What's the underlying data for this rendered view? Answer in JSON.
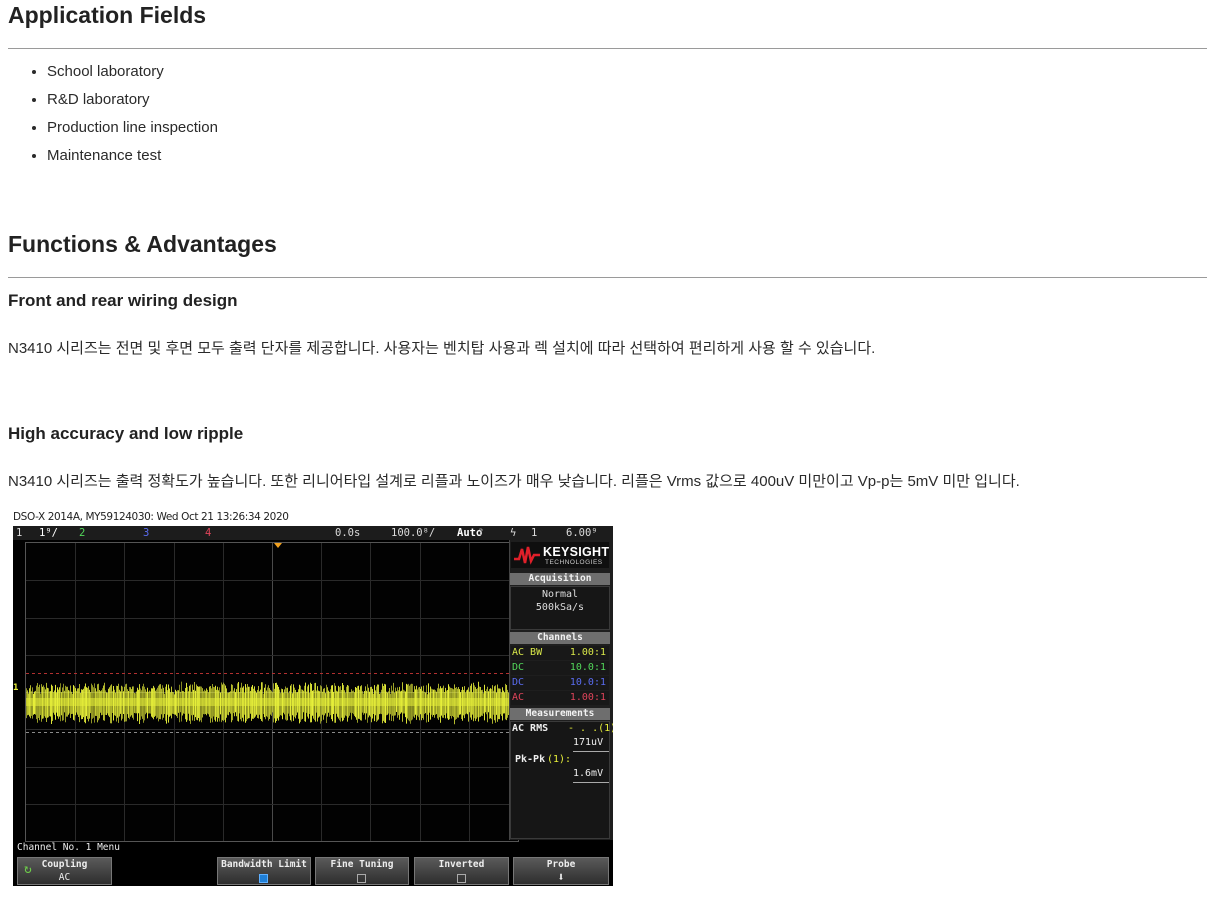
{
  "sections": {
    "application_title": "Application Fields",
    "application_items": [
      "School laboratory",
      "R&D laboratory",
      "Production line inspection",
      "Maintenance test"
    ],
    "functions_title": "Functions & Advantages",
    "wiring_title": "Front and rear wiring design",
    "wiring_text": "N3410 시리즈는 전면 및 후면 모두 출력 단자를 제공합니다. 사용자는 벤치탑 사용과 렉 설치에 따라 선택하여 편리하게 사용 할 수 있습니다.",
    "accuracy_title": "High accuracy and low ripple",
    "accuracy_text": "N3410 시리즈는 출력 정확도가 높습니다.   또한 리니어타입 설계로 리플과 노이즈가 매우 낮습니다. 리플은 Vrms 값으로 400uV 미만이고 Vp-p는 5mV 미만 입니다."
  },
  "scope": {
    "caption": "DSO-X 2014A, MY59124030: Wed Oct 21 13:26:34 2020",
    "top": {
      "ch1_scale": "1",
      "ch1_value": "1⁹/",
      "ch2": "2",
      "ch3": "3",
      "ch4": "4",
      "time_offset": "0.0s",
      "timebase": "100.0⁸/",
      "trigger_mode": "Auto",
      "trigger_symbol": "?",
      "trigger_src": "1",
      "trigger_level": "6.00⁹"
    },
    "logo_text": "KEYSIGHT",
    "logo_sub": "TECHNOLOGIES",
    "acquisition_head": "Acquisition",
    "acq_mode": "Normal",
    "acq_rate": "500kSa/s",
    "channels_head": "Channels",
    "channels": [
      {
        "coupling": "AC BW",
        "probe": "1.00:1",
        "color": "#d9e84a"
      },
      {
        "coupling": "DC",
        "probe": "10.0:1",
        "color": "#52d65a"
      },
      {
        "coupling": "DC",
        "probe": "10.0:1",
        "color": "#5a6cf0"
      },
      {
        "coupling": "AC",
        "probe": "1.00:1",
        "color": "#e0445a"
      }
    ],
    "measurements_head": "Measurements",
    "meas1_label": "AC RMS",
    "meas1_tag": "- . .(1):",
    "meas1_value": "171uV",
    "meas2_label": "Pk-Pk",
    "meas2_tag": "(1):",
    "meas2_value": "1.6mV",
    "menu_title": "Channel No. 1 Menu",
    "softkeys": {
      "coupling": "Coupling",
      "coupling_value": "AC",
      "bandwidth": "Bandwidth Limit",
      "fine": "Fine Tuning",
      "inverted": "Inverted",
      "probe": "Probe"
    },
    "trace_color": "#e8f03a",
    "ch1_marker": "1"
  }
}
